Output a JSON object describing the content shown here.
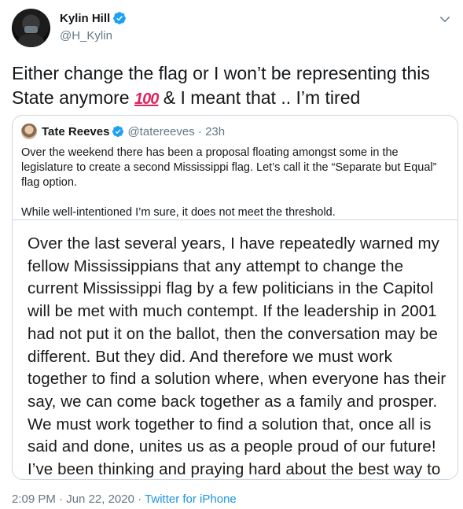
{
  "author": {
    "name": "Kylin Hill",
    "handle": "@H_Kylin"
  },
  "tweet": {
    "text_before_emoji": "Either change the flag or I won’t be representing this State anymore ",
    "emoji": "100",
    "text_after_emoji": " & I meant that .. I’m tired"
  },
  "quoted": {
    "name": "Tate Reeves",
    "handle": "@tatereeves",
    "separator": " · ",
    "age": "23h",
    "paragraph1": "Over the weekend there has been a proposal floating amongst some in the legislature to create a second Mississippi flag. Let’s call it the “Separate but Equal” flag option.",
    "paragraph2": "While well-intentioned I’m sure, it does not meet the threshold.",
    "image_text": "Over the last several years, I have repeatedly warned my fellow Mississippians that any attempt to change the current Mississippi flag by a few politicians in the Capitol will be met with much contempt. If the leadership in 2001 had not put it on the ballot, then the conversation may be different. But they did. And therefore we must work together to find a solution where, when everyone has their say, we can come back together as a family and prosper. We must work together to find a solution that, once all is said and done, unites us as a people proud of our future! I’ve been thinking and praying hard about the best way to"
  },
  "footer": {
    "time": "2:09 PM",
    "separator": " · ",
    "date": "Jun 22, 2020",
    "source": "Twitter for iPhone"
  },
  "colors": {
    "accent": "#1b95e0",
    "verified": "#1da1f2",
    "secondary_text": "#657786",
    "border": "#ccd6dd",
    "emoji": "#e0245e"
  },
  "icons": {
    "verified": "verified-badge-icon",
    "menu": "chevron-down-icon"
  }
}
